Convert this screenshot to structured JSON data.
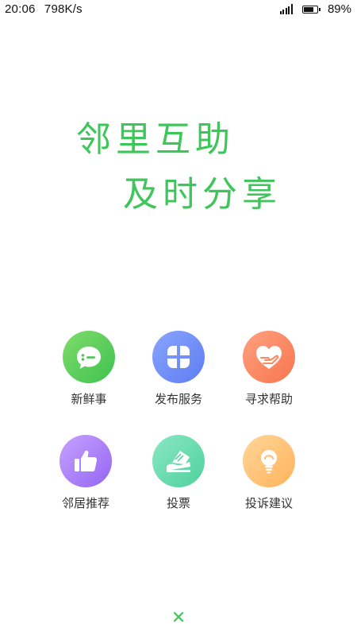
{
  "status_bar": {
    "time": "20:06",
    "speed": "798K/s",
    "battery_percent": "89%",
    "battery_level": 0.89
  },
  "slogan": {
    "line1": "邻里互助",
    "line2": "及时分享",
    "color": "#3ec65a"
  },
  "menu": {
    "items": [
      {
        "label": "新鲜事",
        "icon": "chat-bubble-icon",
        "gradient": [
          "#7fdc6b",
          "#3fc24f"
        ]
      },
      {
        "label": "发布服务",
        "icon": "clover-icon",
        "gradient": [
          "#8aa4ff",
          "#5d7ef2"
        ]
      },
      {
        "label": "寻求帮助",
        "icon": "hand-heart-icon",
        "gradient": [
          "#ffa07f",
          "#f7764f"
        ]
      },
      {
        "label": "邻居推荐",
        "icon": "thumbs-up-icon",
        "gradient": [
          "#c7a1ff",
          "#9466f2"
        ]
      },
      {
        "label": "投票",
        "icon": "ballot-icon",
        "gradient": [
          "#8ae8c5",
          "#4fd09c"
        ]
      },
      {
        "label": "投诉建议",
        "icon": "lightbulb-icon",
        "gradient": [
          "#ffd69a",
          "#ffb35a"
        ]
      }
    ]
  },
  "close": {
    "icon": "close-icon",
    "color": "#3ec65a"
  }
}
